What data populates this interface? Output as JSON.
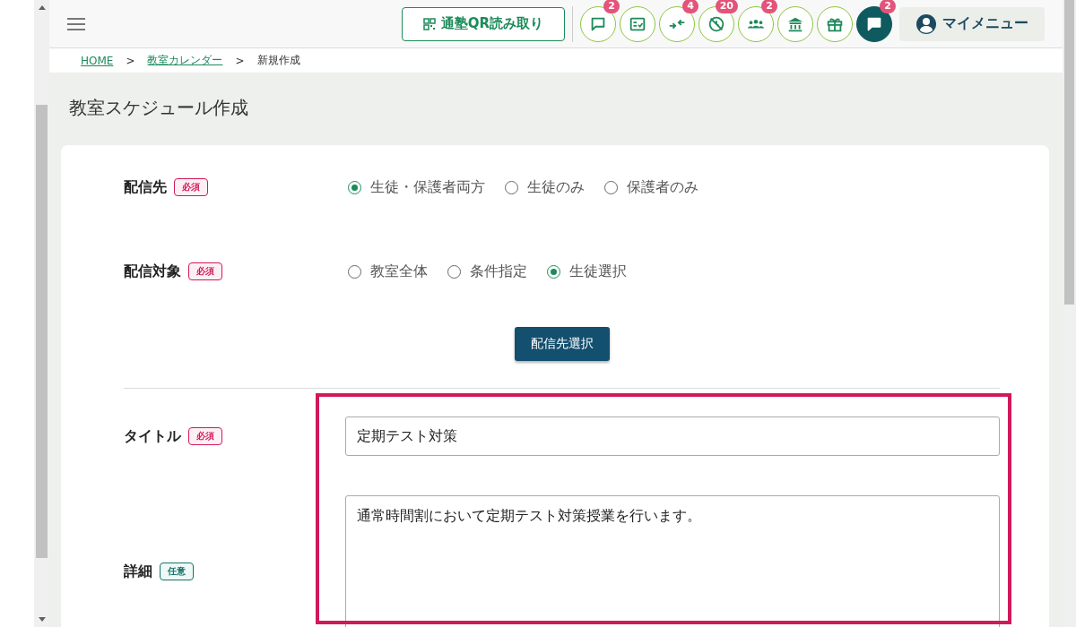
{
  "header": {
    "qr_button": "通塾QR読み取り",
    "icons": [
      {
        "kind": "chat",
        "badge": "2"
      },
      {
        "kind": "checklist"
      },
      {
        "kind": "arrows",
        "badge": "4"
      },
      {
        "kind": "no-clock",
        "badge": "20"
      },
      {
        "kind": "group",
        "badge": "2"
      },
      {
        "kind": "building"
      },
      {
        "kind": "gift"
      },
      {
        "kind": "chat-filled",
        "badge": "2"
      }
    ],
    "my_menu": "マイメニュー"
  },
  "breadcrumb": [
    {
      "label": "HOME",
      "link": true
    },
    {
      "label": ">",
      "link": false
    },
    {
      "label": "教室カレンダー",
      "link": true
    },
    {
      "label": ">",
      "link": false
    },
    {
      "label": "新規作成",
      "link": false
    }
  ],
  "page_title": "教室スケジュール作成",
  "form": {
    "rows": [
      {
        "kind": "radio",
        "label": "配信先",
        "badge": {
          "text": "必須",
          "kind": "required"
        },
        "options": [
          {
            "label": "生徒・保護者両方",
            "selected": true
          },
          {
            "label": "生徒のみ",
            "selected": false
          },
          {
            "label": "保護者のみ",
            "selected": false
          }
        ]
      },
      {
        "kind": "radio",
        "label": "配信対象",
        "badge": {
          "text": "必須",
          "kind": "required"
        },
        "options": [
          {
            "label": "教室全体",
            "selected": false
          },
          {
            "label": "条件指定",
            "selected": false
          },
          {
            "label": "生徒選択",
            "selected": true
          }
        ]
      },
      {
        "kind": "button",
        "label": "配信先選択"
      },
      {
        "kind": "text",
        "label": "タイトル",
        "badge": {
          "text": "必須",
          "kind": "required"
        },
        "value": "定期テスト対策"
      },
      {
        "kind": "textarea",
        "label": "詳細",
        "badge": {
          "text": "任意",
          "kind": "optional"
        },
        "value": "通常時間割において定期テスト対策授業を行います。"
      }
    ]
  }
}
